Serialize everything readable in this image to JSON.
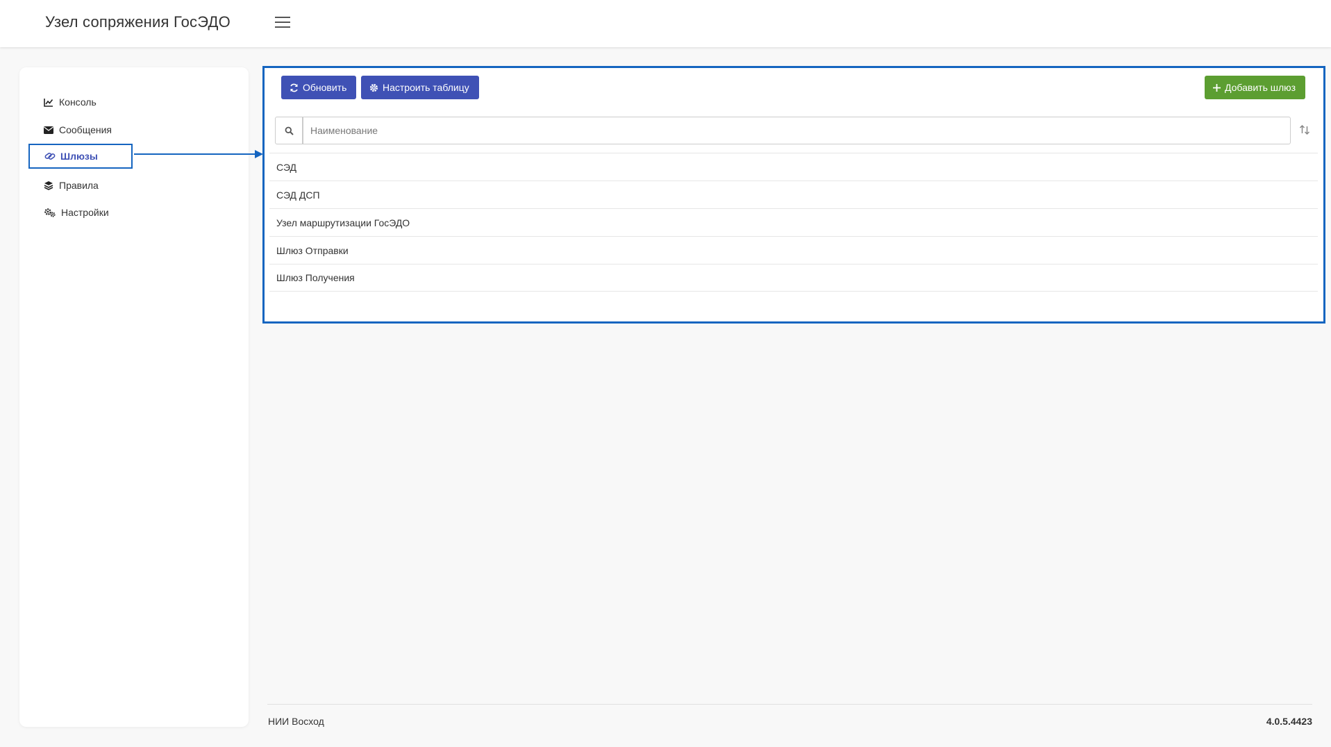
{
  "header": {
    "title": "Узел сопряжения ГосЭДО",
    "menu_icon": "hamburger-menu-icon"
  },
  "sidebar": {
    "items": [
      {
        "label": "Консоль",
        "icon": "chart-line-icon"
      },
      {
        "label": "Сообщения",
        "icon": "envelope-icon"
      },
      {
        "label": "Шлюзы",
        "icon": "link-icon",
        "active": true
      },
      {
        "label": "Правила",
        "icon": "layers-icon"
      },
      {
        "label": "Настройки",
        "icon": "gears-icon"
      }
    ]
  },
  "toolbar": {
    "refresh_label": "Обновить",
    "configure_label": "Настроить таблицу",
    "add_label": "Добавить шлюз"
  },
  "search": {
    "placeholder": "Наименование",
    "value": ""
  },
  "gateways": [
    {
      "name": "СЭД"
    },
    {
      "name": "СЭД ДСП"
    },
    {
      "name": "Узел маршрутизации ГосЭДО"
    },
    {
      "name": "Шлюз Отправки"
    },
    {
      "name": "Шлюз Получения"
    }
  ],
  "footer": {
    "org": "НИИ Восход",
    "version": "4.0.5.4423"
  },
  "colors": {
    "primary": "#3f51b5",
    "success": "#5c9e31",
    "annotation": "#1565c0"
  }
}
